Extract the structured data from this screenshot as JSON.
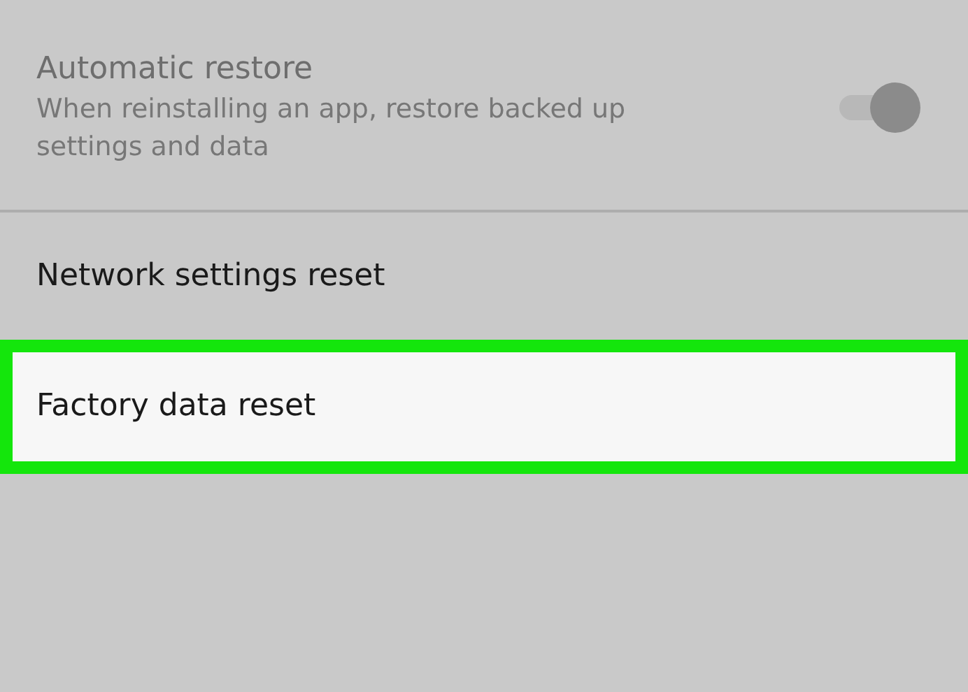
{
  "settings": [
    {
      "kind": "toggle",
      "title": "Automatic restore",
      "summary": "When reinstalling an app, restore backed up settings and data",
      "disabled": true,
      "on": true,
      "highlighted": false
    },
    {
      "kind": "plain",
      "title": "Network settings reset",
      "disabled": false,
      "highlighted": false
    },
    {
      "kind": "plain",
      "title": "Factory data reset",
      "disabled": false,
      "highlighted": true
    }
  ]
}
